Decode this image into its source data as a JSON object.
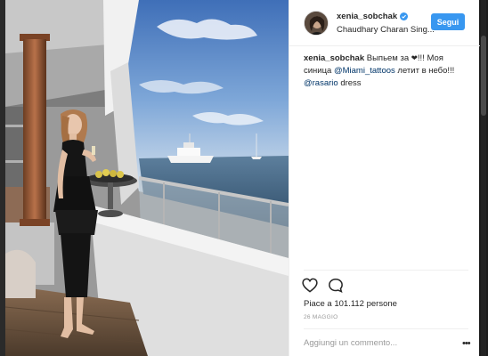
{
  "post": {
    "username": "xenia_sobchak",
    "location": "Chaudhary Charan Sing...",
    "follow_label": "Segui",
    "caption": {
      "username": "xenia_sobchak",
      "text_1": " Выпьем за ",
      "text_2": "!!! Моя синица ",
      "mention_1": "@Miami_tattoos",
      "text_3": " летит в небо!!! ",
      "mention_2": "@rasario",
      "text_4": " dress"
    },
    "likes_text": "Piace a 101.112 persone",
    "date": "26 MAGGIO",
    "comment_placeholder": "Aggiungi un commento...",
    "more_options": "•••"
  },
  "colors": {
    "accent": "#3897f0",
    "mention": "#003569",
    "text": "#262626",
    "muted": "#999999"
  },
  "icons": {
    "verified": "verified-badge-icon",
    "like": "heart-outline-icon",
    "comment": "speech-bubble-icon",
    "more": "ellipsis-icon",
    "caption_heart": "black-heart-emoji"
  }
}
